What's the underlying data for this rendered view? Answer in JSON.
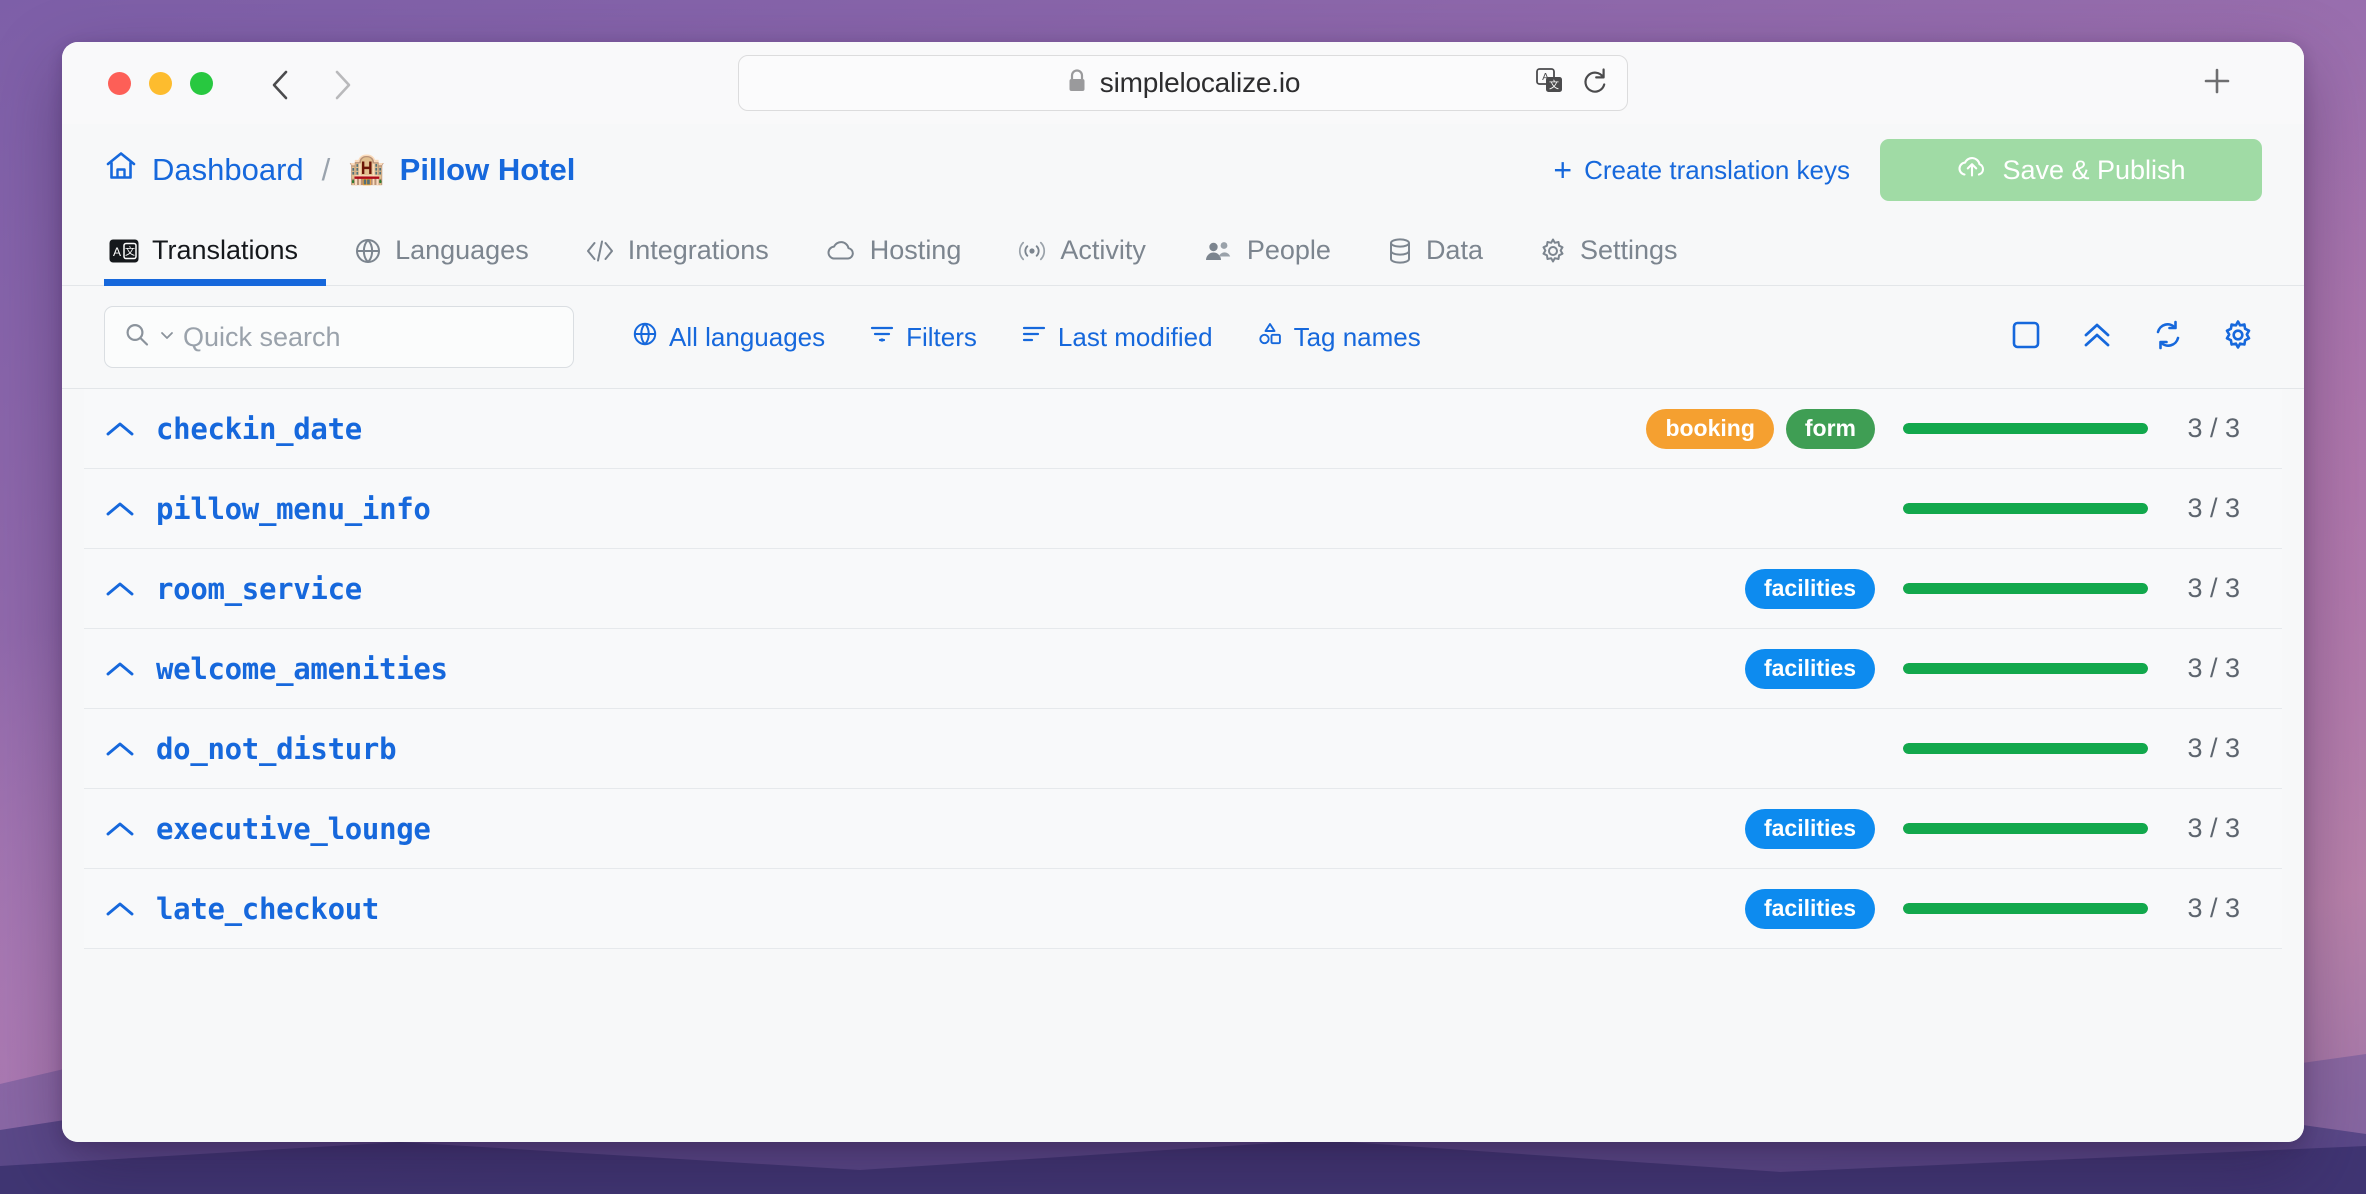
{
  "browser": {
    "url": "simplelocalize.io",
    "lock_icon": "lock-icon",
    "translate_icon": "translate-page-icon",
    "reload_icon": "reload-icon",
    "back_icon": "chevron-left-icon",
    "forward_icon": "chevron-right-icon",
    "new_tab_icon": "plus-icon"
  },
  "breadcrumb": {
    "home_icon": "home-icon",
    "dashboard": "Dashboard",
    "separator": "/",
    "project_emoji": "🏨",
    "project": "Pillow Hotel"
  },
  "topbar_actions": {
    "create_keys_plus": "+",
    "create_keys_label": "Create translation keys",
    "save_publish_label": "Save & Publish",
    "save_publish_icon": "cloud-upload-icon",
    "save_publish_color": "#a0dba5"
  },
  "tabs": [
    {
      "label": "Translations",
      "icon": "translate-icon",
      "active": true
    },
    {
      "label": "Languages",
      "icon": "globe-icon",
      "active": false
    },
    {
      "label": "Integrations",
      "icon": "code-icon",
      "active": false
    },
    {
      "label": "Hosting",
      "icon": "cloud-icon",
      "active": false
    },
    {
      "label": "Activity",
      "icon": "broadcast-icon",
      "active": false
    },
    {
      "label": "People",
      "icon": "users-icon",
      "active": false
    },
    {
      "label": "Data",
      "icon": "database-icon",
      "active": false
    },
    {
      "label": "Settings",
      "icon": "gear-icon",
      "active": false
    }
  ],
  "active_tab_underline_color": "#1668dc",
  "toolbar": {
    "search_placeholder": "Quick search",
    "search_value": "",
    "search_icon": "search-icon",
    "search_chevron_icon": "chevron-down-icon",
    "buttons": [
      {
        "label": "All languages",
        "icon": "globe-icon"
      },
      {
        "label": "Filters",
        "icon": "filter-icon"
      },
      {
        "label": "Last modified",
        "icon": "sort-icon"
      },
      {
        "label": "Tag names",
        "icon": "shapes-icon"
      }
    ],
    "right_icons": [
      {
        "name": "select-all-checkbox-icon"
      },
      {
        "name": "collapse-all-icon"
      },
      {
        "name": "refresh-icon"
      },
      {
        "name": "settings-gear-icon"
      }
    ],
    "accent_color": "#1668dc"
  },
  "tag_colors": {
    "booking": "#f5a030",
    "form": "#3f9e54",
    "facilities": "#0d8bef"
  },
  "progress_color": "#12a84c",
  "rows": [
    {
      "key": "checkin_date",
      "chevron": "chevron-up-icon",
      "tags": [
        "booking",
        "form"
      ],
      "translated": 3,
      "total": 3,
      "count_label": "3 / 3",
      "percent": 100
    },
    {
      "key": "pillow_menu_info",
      "chevron": "chevron-up-icon",
      "tags": [],
      "translated": 3,
      "total": 3,
      "count_label": "3 / 3",
      "percent": 100
    },
    {
      "key": "room_service",
      "chevron": "chevron-up-icon",
      "tags": [
        "facilities"
      ],
      "translated": 3,
      "total": 3,
      "count_label": "3 / 3",
      "percent": 100
    },
    {
      "key": "welcome_amenities",
      "chevron": "chevron-up-icon",
      "tags": [
        "facilities"
      ],
      "translated": 3,
      "total": 3,
      "count_label": "3 / 3",
      "percent": 100
    },
    {
      "key": "do_not_disturb",
      "chevron": "chevron-up-icon",
      "tags": [],
      "translated": 3,
      "total": 3,
      "count_label": "3 / 3",
      "percent": 100
    },
    {
      "key": "executive_lounge",
      "chevron": "chevron-up-icon",
      "tags": [
        "facilities"
      ],
      "translated": 3,
      "total": 3,
      "count_label": "3 / 3",
      "percent": 100
    },
    {
      "key": "late_checkout",
      "chevron": "chevron-up-icon",
      "tags": [
        "facilities"
      ],
      "translated": 3,
      "total": 3,
      "count_label": "3 / 3",
      "percent": 100
    }
  ]
}
